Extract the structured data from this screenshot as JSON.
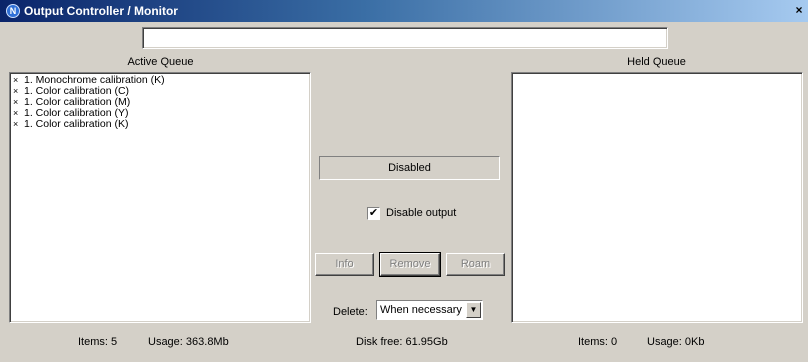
{
  "window": {
    "title": "Output Controller / Monitor",
    "close_glyph": "×",
    "icon_letter": "N"
  },
  "top_field": {
    "value": ""
  },
  "active_queue": {
    "label": "Active Queue",
    "items": [
      {
        "mark": "×",
        "text": "1. Monochrome calibration (K)"
      },
      {
        "mark": "×",
        "text": "1. Color calibration (C)"
      },
      {
        "mark": "×",
        "text": "1. Color calibration (M)"
      },
      {
        "mark": "×",
        "text": "1. Color calibration (Y)"
      },
      {
        "mark": "×",
        "text": "1. Color calibration (K)"
      }
    ]
  },
  "held_queue": {
    "label": "Held Queue",
    "items": []
  },
  "center": {
    "status_text": "Disabled",
    "disable_output": {
      "label": "Disable output",
      "checked": true,
      "check_glyph": "✔"
    },
    "buttons": {
      "info": "Info",
      "remove": "Remove",
      "roam": "Roam"
    },
    "delete_label": "Delete:",
    "delete_select": {
      "value": "When necessary",
      "arrow_glyph": "▼"
    }
  },
  "status_bar": {
    "left_items": "Items: 5",
    "left_usage": "Usage: 363.8Mb",
    "disk_free": "Disk free: 61.95Gb",
    "right_items": "Items: 0",
    "right_usage": "Usage: 0Kb"
  },
  "colors": {
    "window_bg": "#d4d0c8",
    "titlebar_start": "#0a246a",
    "titlebar_end": "#a6caf0",
    "disabled_text": "#808080"
  }
}
